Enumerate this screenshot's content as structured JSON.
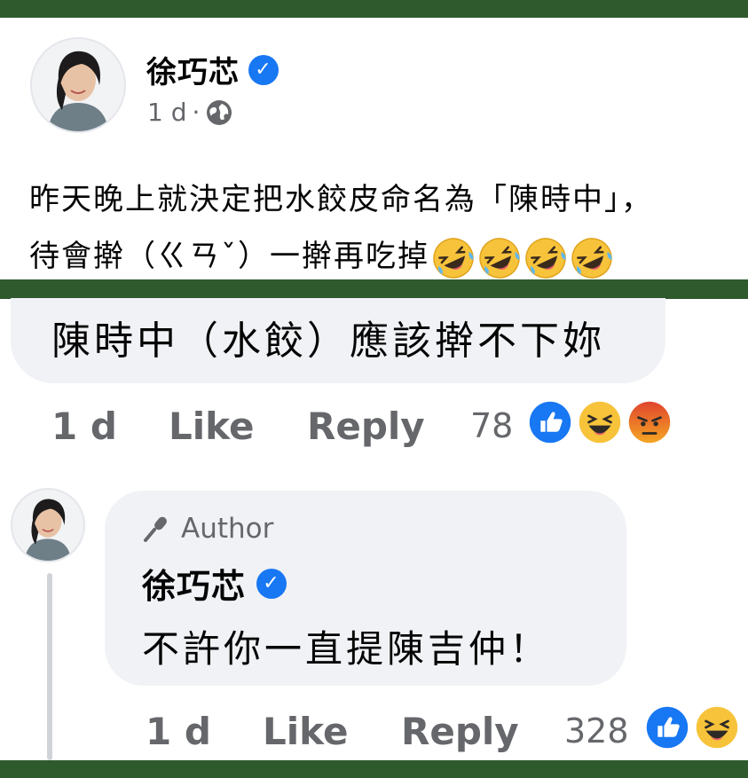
{
  "post": {
    "author": "徐巧芯",
    "time": "1 d",
    "separator": "·",
    "text_line1": "昨天晚上就決定把水餃皮命名為「陳時中」，",
    "text_line2": "待會擀（ㄍㄢˇ）一擀再吃掉",
    "emoji_count": 4,
    "emoji_name": "rolling-on-floor-laughing-emoji"
  },
  "comment": {
    "text": "陳時中（水餃）應該擀不下妳",
    "time": "1 d",
    "like_label": "Like",
    "reply_label": "Reply",
    "reaction_count": "78",
    "reactions": [
      "like",
      "haha",
      "angry"
    ]
  },
  "reply": {
    "badge": "Author",
    "author": "徐巧芯",
    "text": "不許你一直提陳吉仲！",
    "time": "1 d",
    "like_label": "Like",
    "reply_label": "Reply",
    "reaction_count": "328",
    "reactions": [
      "like",
      "haha"
    ]
  },
  "colors": {
    "frame_green": "#2f5a2e",
    "verified_blue": "#1877f2",
    "bubble_gray": "#f0f2f5",
    "meta_gray": "#65676b",
    "angry_red": "#e0452f",
    "haha_yellow": "#f7c33b"
  }
}
